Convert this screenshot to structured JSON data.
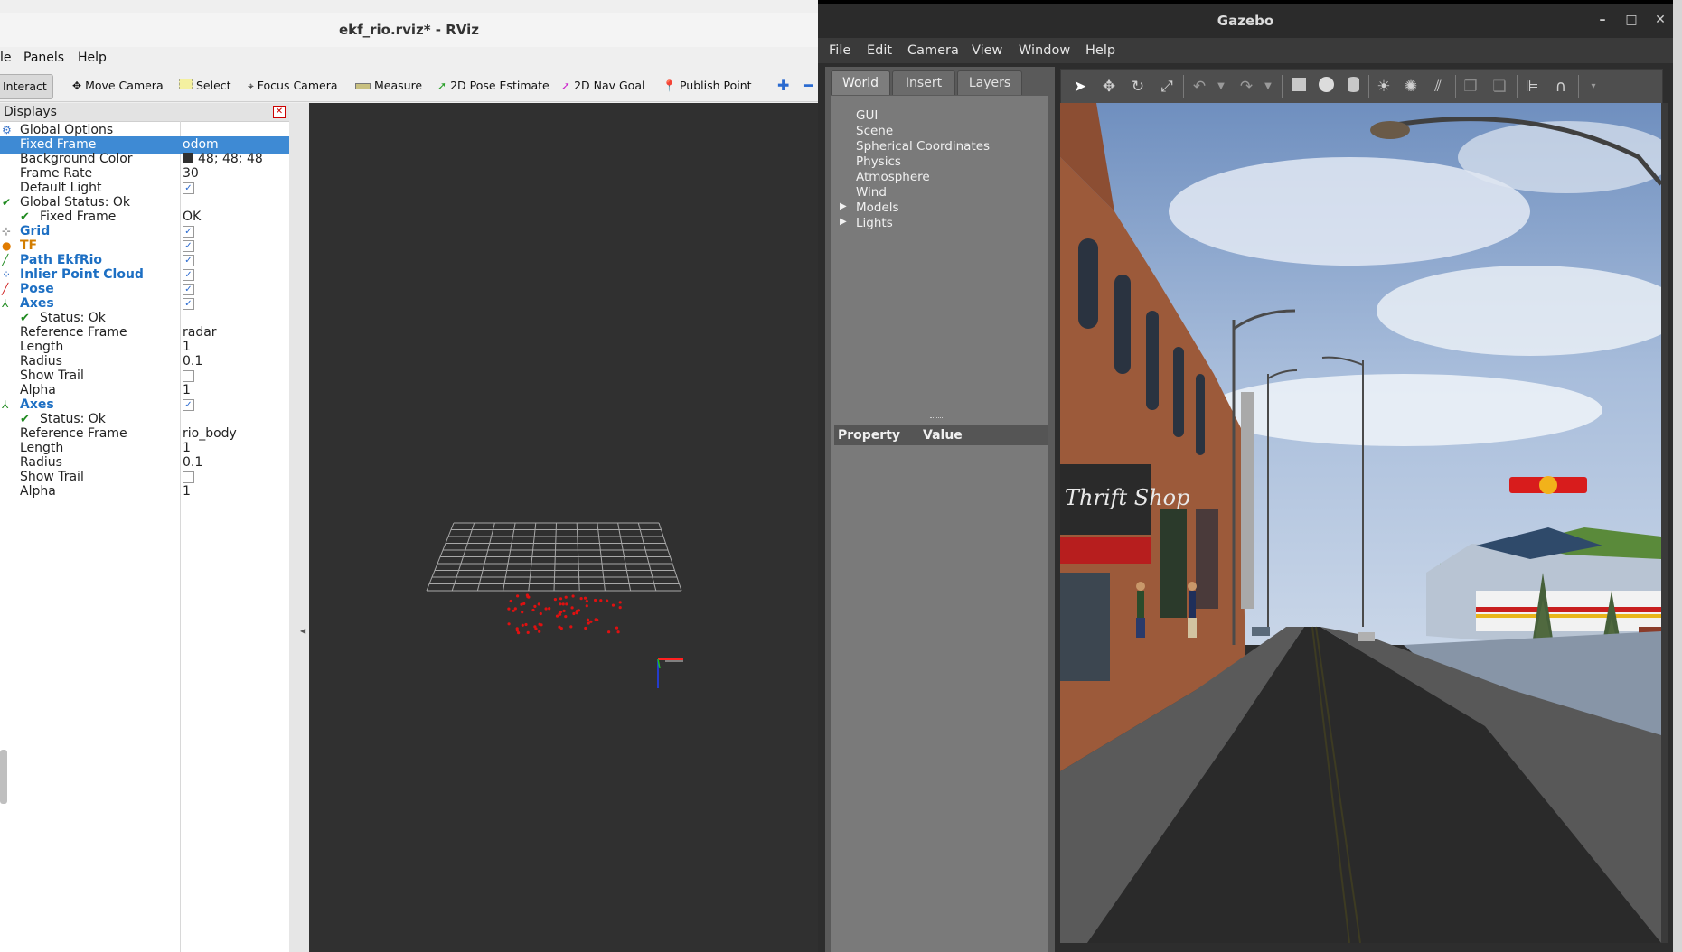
{
  "rviz": {
    "title": "ekf_rio.rviz* - RViz",
    "menu": [
      "le",
      "Panels",
      "Help"
    ],
    "toolbar": [
      "Interact",
      "Move Camera",
      "Select",
      "Focus Camera",
      "Measure",
      "2D Pose Estimate",
      "2D Nav Goal",
      "Publish Point"
    ],
    "displays_title": "Displays",
    "rows": [
      {
        "key": "Global Options",
        "value": "",
        "style": "root"
      },
      {
        "key": "Fixed Frame",
        "value": "odom",
        "style": "selected"
      },
      {
        "key": "Background Color",
        "value": "48; 48; 48",
        "style": "plain"
      },
      {
        "key": "Frame Rate",
        "value": "30",
        "style": "plain"
      },
      {
        "key": "Default Light",
        "value": "",
        "style": "plain"
      },
      {
        "key": "Global Status: Ok",
        "value": "",
        "style": "root"
      },
      {
        "key": "Fixed Frame",
        "value": "OK",
        "style": "sub"
      },
      {
        "key": "Grid",
        "value": "",
        "style": "cat"
      },
      {
        "key": "TF",
        "value": "",
        "style": "cat"
      },
      {
        "key": "Path EkfRio",
        "value": "",
        "style": "cat"
      },
      {
        "key": "Inlier Point Cloud",
        "value": "",
        "style": "cat"
      },
      {
        "key": "Pose",
        "value": "",
        "style": "cat"
      },
      {
        "key": "Axes",
        "value": "",
        "style": "cat"
      },
      {
        "key": "Status: Ok",
        "value": "",
        "style": "sub"
      },
      {
        "key": "Reference Frame",
        "value": "radar",
        "style": "plain"
      },
      {
        "key": "Length",
        "value": "1",
        "style": "plain"
      },
      {
        "key": "Radius",
        "value": "0.1",
        "style": "plain"
      },
      {
        "key": "Show Trail",
        "value": "",
        "style": "plain"
      },
      {
        "key": "Alpha",
        "value": "1",
        "style": "plain"
      },
      {
        "key": "Axes",
        "value": "",
        "style": "cat"
      },
      {
        "key": "Status: Ok",
        "value": "",
        "style": "sub"
      },
      {
        "key": "Reference Frame",
        "value": "rio_body",
        "style": "plain"
      },
      {
        "key": "Length",
        "value": "1",
        "style": "plain"
      },
      {
        "key": "Radius",
        "value": "0.1",
        "style": "plain"
      },
      {
        "key": "Show Trail",
        "value": "",
        "style": "plain"
      },
      {
        "key": "Alpha",
        "value": "1",
        "style": "plain"
      }
    ],
    "checkbox_states": {
      "Default Light": true,
      "Grid": true,
      "TF": true,
      "Path EkfRio": true,
      "Inlier Point Cloud": true,
      "Pose": true,
      "Axes": true,
      "Show Trail": false
    },
    "background_color_hex": "#303030"
  },
  "gazebo": {
    "title": "Gazebo",
    "menu": [
      "File",
      "Edit",
      "Camera",
      "View",
      "Window",
      "Help"
    ],
    "tabs": [
      "World",
      "Insert",
      "Layers"
    ],
    "world_items": [
      "GUI",
      "Scene",
      "Spherical Coordinates",
      "Physics",
      "Atmosphere",
      "Wind",
      "Models",
      "Lights"
    ],
    "property_header": "Property",
    "value_header": "Value",
    "scene_sign_text": "Thrift Shop",
    "window_controls": [
      "–",
      "□",
      "✕"
    ]
  },
  "colors": {
    "selection": "#3e8ad4",
    "category_blue": "#1d6fc3",
    "tf_orange": "#d27d00",
    "pointcloud_red": "#e01010"
  }
}
